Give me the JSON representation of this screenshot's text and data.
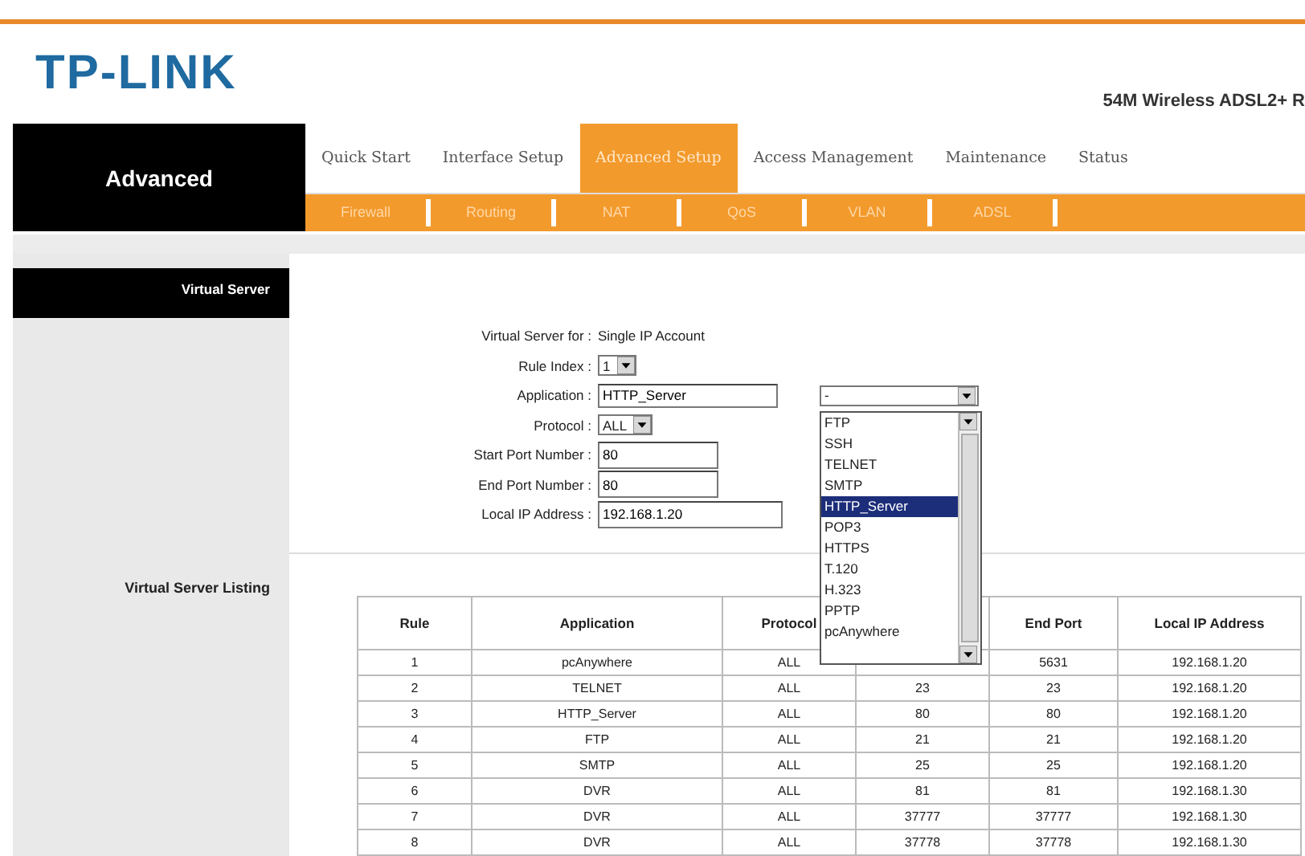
{
  "header": {
    "logo": "TP-LINK",
    "model": "54M Wireless ADSL2+ R"
  },
  "nav": {
    "section": "Advanced",
    "tabs": [
      {
        "label": "Quick Start",
        "selected": false
      },
      {
        "label": "Interface Setup",
        "selected": false
      },
      {
        "label": "Advanced Setup",
        "selected": true
      },
      {
        "label": "Access Management",
        "selected": false
      },
      {
        "label": "Maintenance",
        "selected": false
      },
      {
        "label": "Status",
        "selected": false
      }
    ],
    "subtabs": [
      "Firewall",
      "Routing",
      "NAT",
      "QoS",
      "VLAN",
      "ADSL"
    ]
  },
  "sidebar": {
    "title": "Virtual Server",
    "listing_label": "Virtual Server Listing"
  },
  "form": {
    "virtual_server_for": {
      "label": "Virtual Server for :",
      "value": "Single IP Account"
    },
    "rule_index": {
      "label": "Rule Index :",
      "value": "1"
    },
    "application": {
      "label": "Application :",
      "value": "HTTP_Server",
      "combo_value": "-"
    },
    "protocol": {
      "label": "Protocol :",
      "value": "ALL"
    },
    "start_port": {
      "label": "Start Port Number :",
      "value": "80"
    },
    "end_port": {
      "label": "End Port Number :",
      "value": "80"
    },
    "local_ip": {
      "label": "Local IP Address :",
      "value": "192.168.1.20"
    }
  },
  "dropdown": {
    "options": [
      {
        "label": "FTP",
        "selected": false
      },
      {
        "label": "SSH",
        "selected": false
      },
      {
        "label": "TELNET",
        "selected": false
      },
      {
        "label": "SMTP",
        "selected": false
      },
      {
        "label": "HTTP_Server",
        "selected": true
      },
      {
        "label": "POP3",
        "selected": false
      },
      {
        "label": "HTTPS",
        "selected": false
      },
      {
        "label": "T.120",
        "selected": false
      },
      {
        "label": "H.323",
        "selected": false
      },
      {
        "label": "PPTP",
        "selected": false
      },
      {
        "label": "pcAnywhere",
        "selected": false
      }
    ]
  },
  "table": {
    "columns": [
      "Rule",
      "Application",
      "Protocol",
      "",
      "End Port",
      "Local IP Address"
    ],
    "rows": [
      [
        "1",
        "pcAnywhere",
        "ALL",
        "",
        "5631",
        "192.168.1.20"
      ],
      [
        "2",
        "TELNET",
        "ALL",
        "23",
        "23",
        "192.168.1.20"
      ],
      [
        "3",
        "HTTP_Server",
        "ALL",
        "80",
        "80",
        "192.168.1.20"
      ],
      [
        "4",
        "FTP",
        "ALL",
        "21",
        "21",
        "192.168.1.20"
      ],
      [
        "5",
        "SMTP",
        "ALL",
        "25",
        "25",
        "192.168.1.20"
      ],
      [
        "6",
        "DVR",
        "ALL",
        "81",
        "81",
        "192.168.1.30"
      ],
      [
        "7",
        "DVR",
        "ALL",
        "37777",
        "37777",
        "192.168.1.30"
      ],
      [
        "8",
        "DVR",
        "ALL",
        "37778",
        "37778",
        "192.168.1.30"
      ]
    ]
  }
}
